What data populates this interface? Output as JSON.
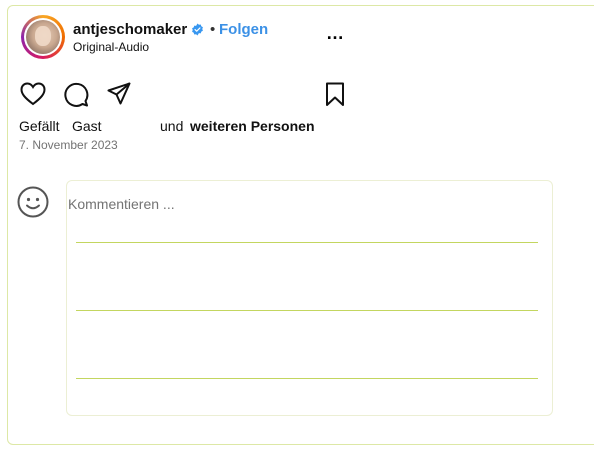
{
  "post": {
    "username": "antjeschomaker",
    "separator": "•",
    "follow_label": "Folgen",
    "audio_label": "Original-Audio",
    "more_label": "…"
  },
  "actions": {
    "icons": [
      "heart-icon",
      "comment-icon",
      "share-icon",
      "bookmark-icon"
    ]
  },
  "likes": {
    "prefix": "Gefällt",
    "user": "Gast",
    "middle": "und",
    "suffix": "weiteren Personen"
  },
  "date": "7. November 2023",
  "comment": {
    "placeholder": "Kommentieren ..."
  },
  "colors": {
    "follow": "#3c91e6",
    "verified": "#3897f0",
    "border": "#dde8a6",
    "lines": "#c3d660"
  }
}
